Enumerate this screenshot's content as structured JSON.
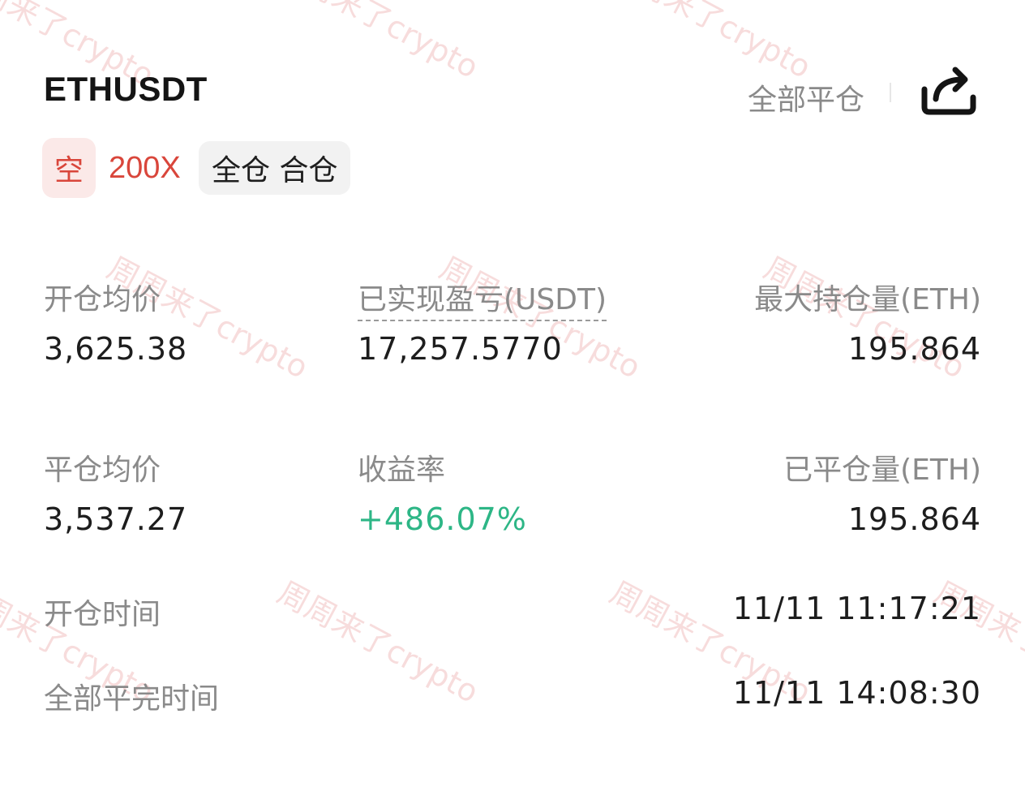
{
  "header": {
    "symbol": "ETHUSDT",
    "close_all_label": "全部平仓",
    "share_icon": "share-icon"
  },
  "tags": {
    "direction": "空",
    "leverage": "200X",
    "margin_mode": "全仓 合仓"
  },
  "stats": {
    "open_avg_price": {
      "label": "开仓均价",
      "value": "3,625.38"
    },
    "realized_pnl": {
      "label": "已实现盈亏(USDT)",
      "value": "17,257.5770"
    },
    "max_position": {
      "label": "最大持仓量(ETH)",
      "value": "195.864"
    },
    "close_avg_price": {
      "label": "平仓均价",
      "value": "3,537.27"
    },
    "return_rate": {
      "label": "收益率",
      "value": "+486.07%"
    },
    "closed_amount": {
      "label": "已平仓量(ETH)",
      "value": "195.864"
    },
    "open_time": {
      "label": "开仓时间",
      "value": "11/11 11:17:21"
    },
    "full_close_time": {
      "label": "全部平完时间",
      "value": "11/11 14:08:30"
    }
  },
  "watermark": {
    "text": "周周来了crypto"
  },
  "colors": {
    "short_red": "#d9463b",
    "short_bg": "#fbe9e8",
    "profit_green": "#2db686",
    "muted_label": "#8a8a8a"
  }
}
